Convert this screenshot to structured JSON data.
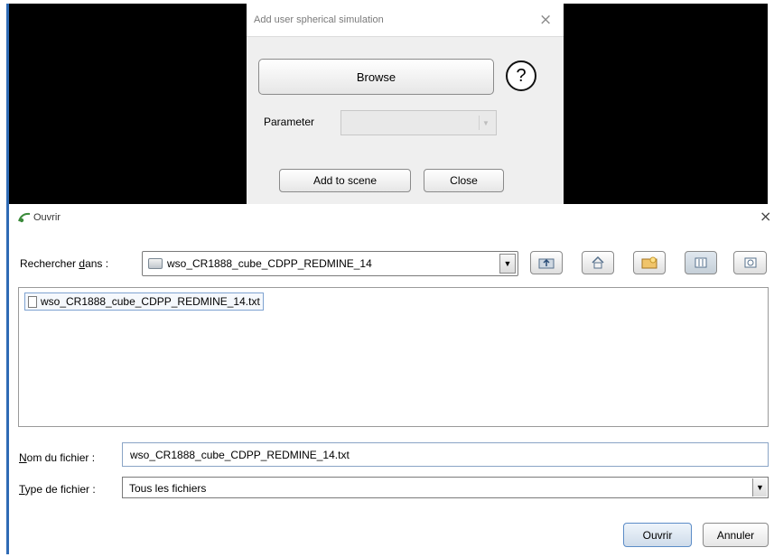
{
  "add_dialog": {
    "title": "Add user spherical simulation",
    "close_icon": "×",
    "browse_label": "Browse",
    "help_label": "?",
    "parameter_label": "Parameter",
    "parameter_value": "",
    "add_to_scene_label": "Add to scene",
    "close_label": "Close"
  },
  "file_chooser": {
    "title": "Ouvrir",
    "close_icon": "×",
    "look_in_label_pre": "Rechercher ",
    "look_in_label_mnemonic": "d",
    "look_in_label_post": "ans :",
    "look_in_value": "wso_CR1888_cube_CDPP_REDMINE_14",
    "toolbar_icons": [
      "up-folder-icon",
      "home-icon",
      "new-folder-icon",
      "list-view-icon",
      "details-view-icon"
    ],
    "files": [
      {
        "name": "wso_CR1888_cube_CDPP_REDMINE_14.txt"
      }
    ],
    "file_name_label_mnemonic": "N",
    "file_name_label_rest": "om du fichier :",
    "file_name_value": "wso_CR1888_cube_CDPP_REDMINE_14.txt",
    "file_type_label_mnemonic": "T",
    "file_type_label_rest": "ype de fichier :",
    "file_type_value": "Tous les fichiers",
    "open_label": "Ouvrir",
    "cancel_label": "Annuler"
  },
  "colors": {
    "background_dark": "#000000",
    "window_edge": "#2f6bb5",
    "selection_border": "#7fa3d1"
  }
}
